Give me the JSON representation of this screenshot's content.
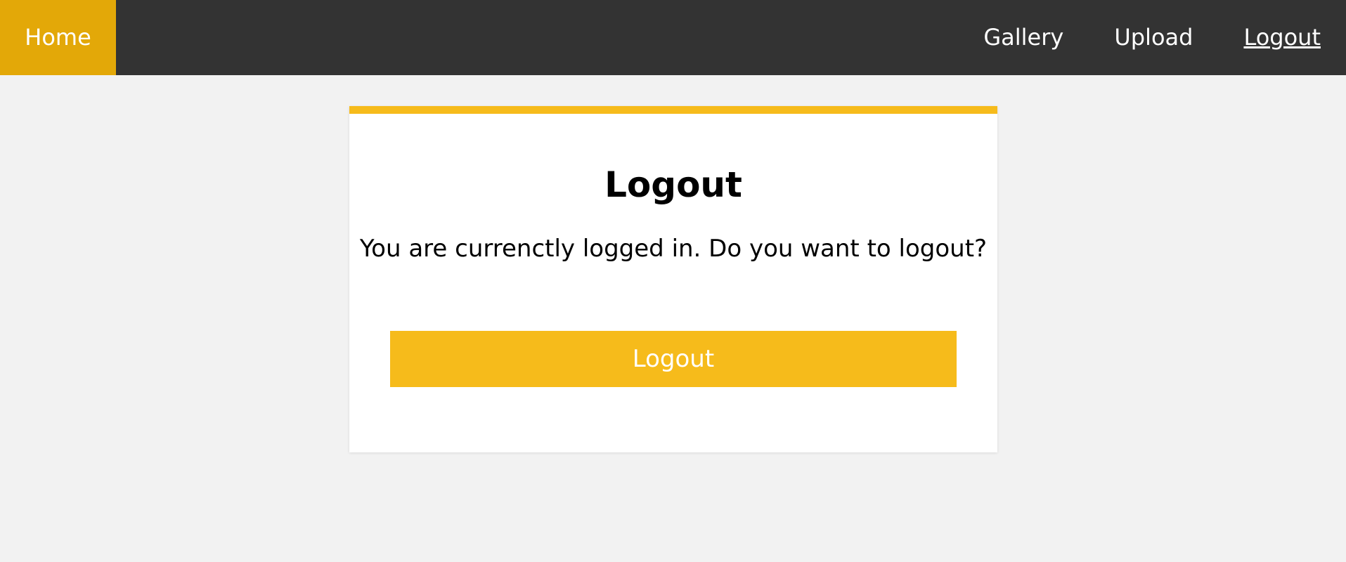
{
  "nav": {
    "home": "Home",
    "links": [
      "Gallery",
      "Upload",
      "Logout"
    ],
    "active_index": 2
  },
  "card": {
    "title": "Logout",
    "message": "You are currenctly logged in. Do you want to logout?",
    "button_label": "Logout"
  },
  "colors": {
    "navbar_bg": "#333333",
    "home_bg": "#e3a808",
    "accent": "#f6bb1b",
    "page_bg": "#f2f2f2"
  }
}
